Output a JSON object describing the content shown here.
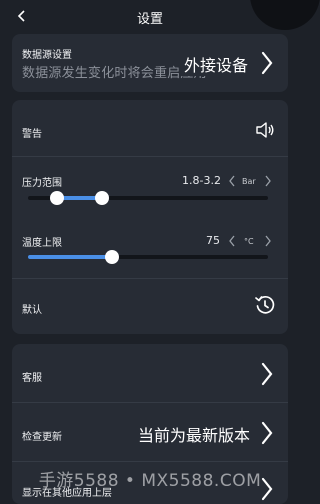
{
  "header": {
    "title": "设置"
  },
  "data_source": {
    "label": "数据源设置",
    "subtitle": "数据源发生变化时将会重启应用",
    "value": "外接设备"
  },
  "alarm": {
    "label": "警告"
  },
  "pressure": {
    "label": "压力范围",
    "value": "1.8-3.2",
    "unit": "Bar",
    "range_low": 0.12,
    "range_high": 0.31
  },
  "temperature": {
    "label": "温度上限",
    "value": "75",
    "unit": "°C",
    "level": 0.35
  },
  "default": {
    "label": "默认"
  },
  "support": {
    "label": "客服"
  },
  "update": {
    "label": "检查更新",
    "status": "当前为最新版本"
  },
  "overlay": {
    "label": "显示在其他应用上层"
  },
  "watermark": "手游5588 • MX5588.COM",
  "colors": {
    "background": "#1d2128",
    "card": "#272c35",
    "accent": "#4a8fe7",
    "track": "#12151a"
  }
}
